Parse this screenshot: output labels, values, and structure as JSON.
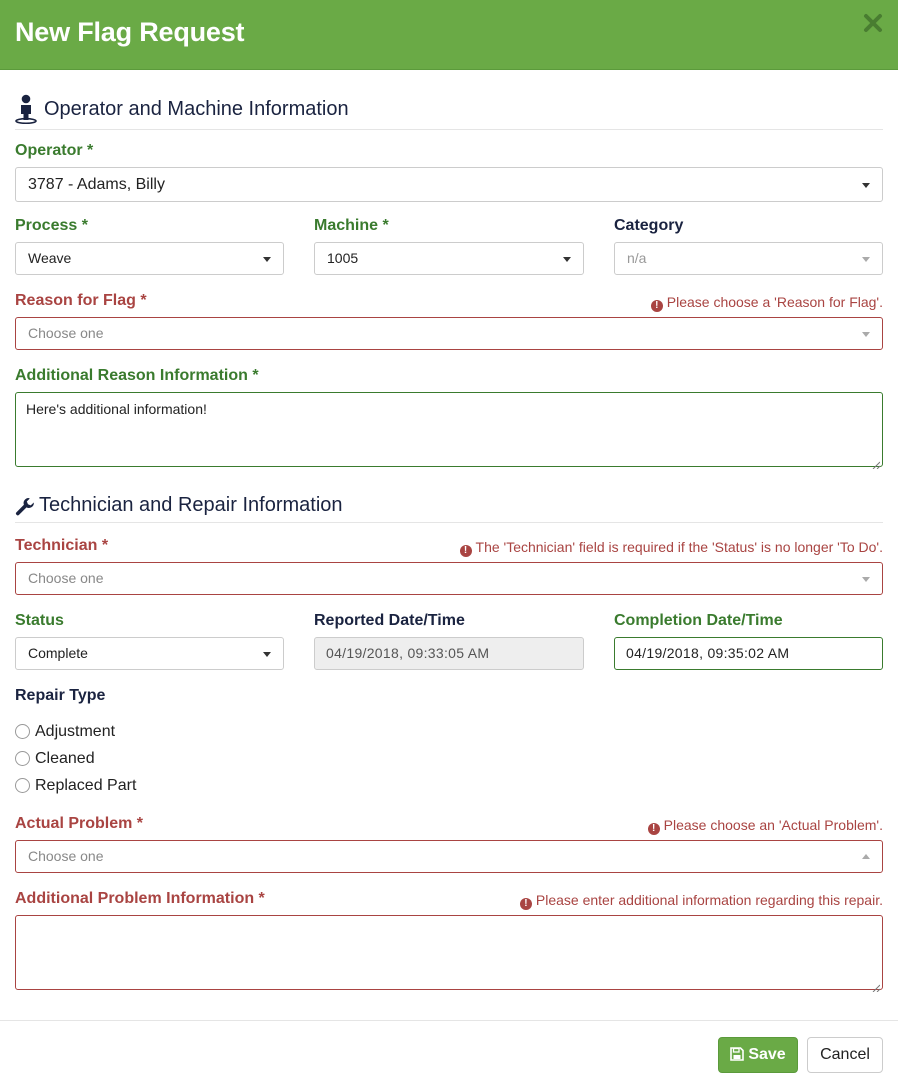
{
  "header": {
    "title": "New Flag Request"
  },
  "section1": {
    "title": "Operator and Machine Information"
  },
  "operator": {
    "label": "Operator *",
    "value": "3787 - Adams, Billy"
  },
  "process": {
    "label": "Process *",
    "value": "Weave"
  },
  "machine": {
    "label": "Machine *",
    "value": "1005"
  },
  "category": {
    "label": "Category",
    "value": "n/a"
  },
  "reason": {
    "label": "Reason for Flag *",
    "error": "Please choose a 'Reason for Flag'.",
    "placeholder": "Choose one"
  },
  "additional_reason": {
    "label": "Additional Reason Information *",
    "value": "Here's additional information!"
  },
  "section2": {
    "title": "Technician and Repair Information"
  },
  "technician": {
    "label": "Technician *",
    "error": "The 'Technician' field is required if the 'Status' is no longer 'To Do'.",
    "placeholder": "Choose one"
  },
  "status": {
    "label": "Status",
    "value": "Complete"
  },
  "reported": {
    "label": "Reported Date/Time",
    "value": "04/19/2018, 09:33:05 AM"
  },
  "completion": {
    "label": "Completion Date/Time",
    "value": "04/19/2018, 09:35:02 AM"
  },
  "repair_type": {
    "label": "Repair Type",
    "options": [
      "Adjustment",
      "Cleaned",
      "Replaced Part"
    ]
  },
  "actual_problem": {
    "label": "Actual Problem *",
    "error": "Please choose an 'Actual Problem'.",
    "placeholder": "Choose one"
  },
  "additional_problem": {
    "label": "Additional Problem Information *",
    "error": "Please enter additional information regarding this repair.",
    "value": ""
  },
  "footer": {
    "save_label": "Save",
    "cancel_label": "Cancel"
  },
  "colors": {
    "brand": "#6aaa46",
    "valid": "#3a7b2e",
    "error": "#a94442",
    "heading": "#1a2340"
  }
}
